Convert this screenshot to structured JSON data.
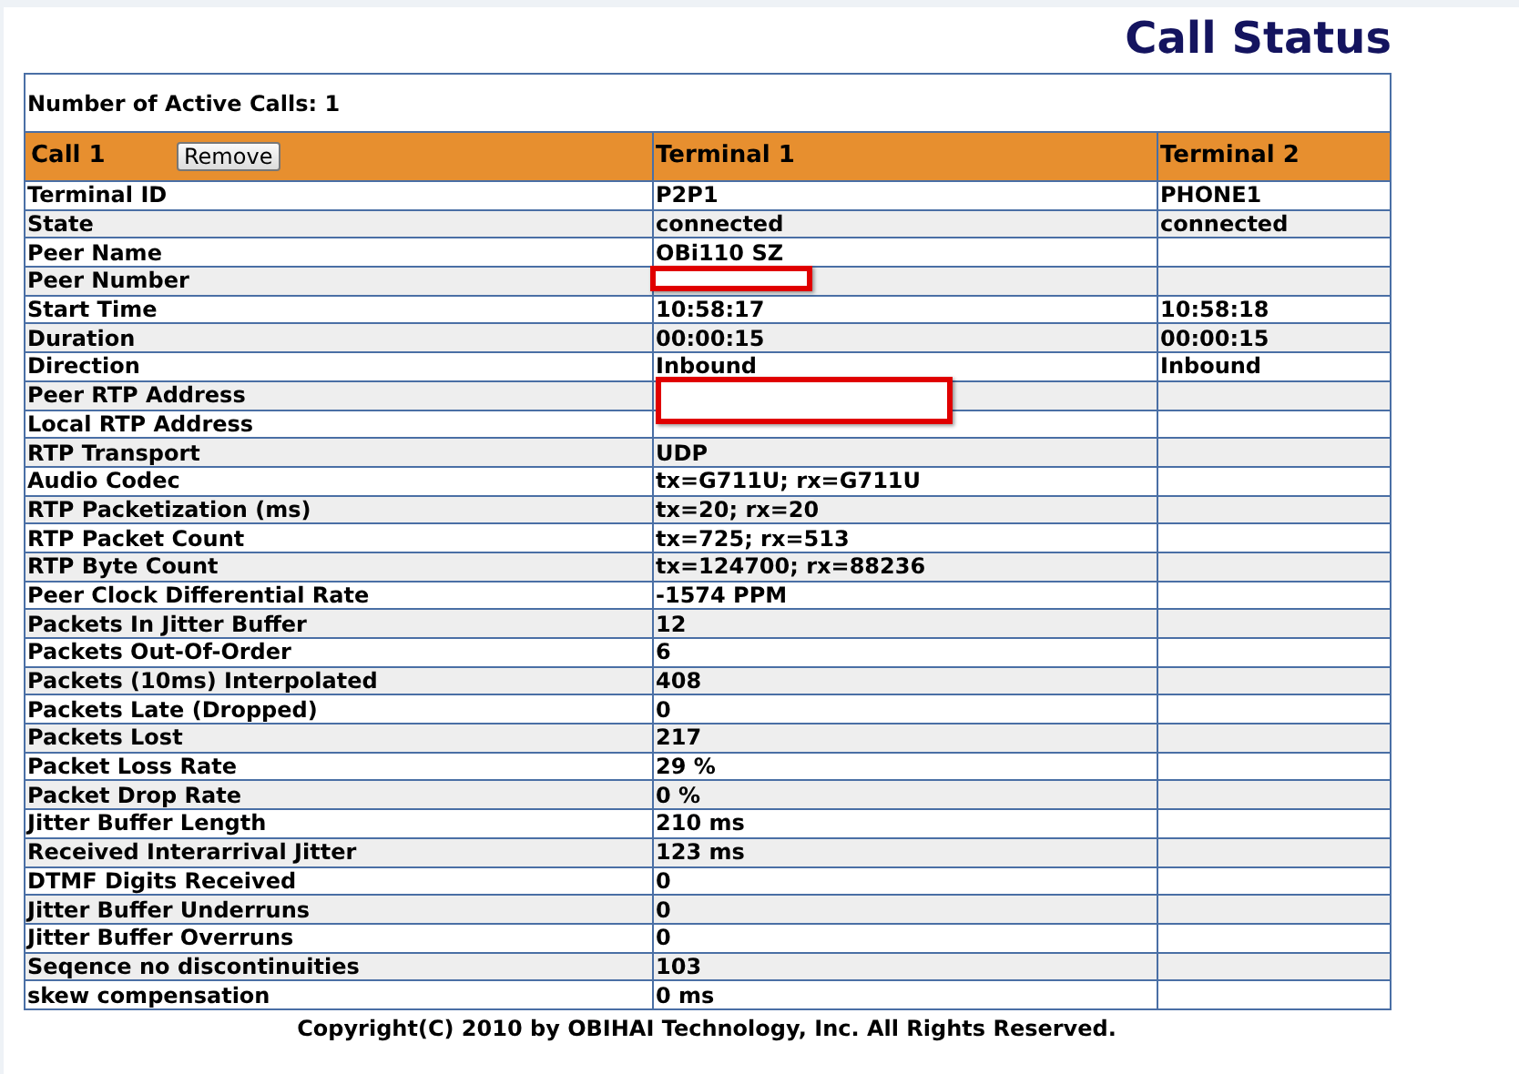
{
  "title": "Call Status",
  "active_calls": "Number of Active Calls: 1",
  "header": {
    "call": "Call 1",
    "button": "Remove",
    "columns": [
      "Terminal 1",
      "Terminal 2"
    ]
  },
  "rows": [
    {
      "label": "Terminal ID",
      "values": [
        "P2P1",
        "PHONE1"
      ]
    },
    {
      "label": "State",
      "values": [
        "connected",
        "connected"
      ]
    },
    {
      "label": "Peer Name",
      "values": [
        "OBi110 SZ"
      ]
    },
    {
      "label": "Peer Number",
      "values": [],
      "redacted": true,
      "redaction_wide": false
    },
    {
      "label": "Start Time",
      "values": [
        "10:58:17",
        "10:58:18"
      ]
    },
    {
      "label": "Duration",
      "values": [
        "00:00:15",
        "00:00:15"
      ]
    },
    {
      "label": "Direction",
      "values": [
        "Inbound",
        "Inbound"
      ]
    },
    {
      "label": "Peer RTP Address",
      "values": [],
      "redacted": true,
      "redaction_wide": true
    },
    {
      "label": "Local RTP Address",
      "values": []
    },
    {
      "label": "RTP Transport",
      "values": [
        "UDP"
      ]
    },
    {
      "label": "Audio Codec",
      "values": [
        "tx=G711U; rx=G711U"
      ]
    },
    {
      "label": "RTP Packetization (ms)",
      "values": [
        "tx=20; rx=20"
      ]
    },
    {
      "label": "RTP Packet Count",
      "values": [
        "tx=725; rx=513"
      ]
    },
    {
      "label": "RTP Byte Count",
      "values": [
        "tx=124700; rx=88236"
      ]
    },
    {
      "label": "Peer Clock Differential Rate",
      "values": [
        "-1574 PPM"
      ]
    },
    {
      "label": "Packets In Jitter Buffer",
      "values": [
        "12"
      ]
    },
    {
      "label": "Packets Out-Of-Order",
      "values": [
        "6"
      ]
    },
    {
      "label": "Packets (10ms) Interpolated",
      "values": [
        "408"
      ]
    },
    {
      "label": "Packets Late (Dropped)",
      "values": [
        "0"
      ]
    },
    {
      "label": "Packets Lost",
      "values": [
        "217"
      ]
    },
    {
      "label": "Packet Loss Rate",
      "values": [
        "29 %"
      ]
    },
    {
      "label": "Packet Drop Rate",
      "values": [
        "0 %"
      ]
    },
    {
      "label": "Jitter Buffer Length",
      "values": [
        "210 ms"
      ]
    },
    {
      "label": "Received Interarrival Jitter",
      "values": [
        "123 ms"
      ]
    },
    {
      "label": "DTMF Digits Received",
      "values": [
        "0"
      ]
    },
    {
      "label": "Jitter Buffer Underruns",
      "values": [
        "0"
      ]
    },
    {
      "label": "Jitter Buffer Overruns",
      "values": [
        "0"
      ]
    },
    {
      "label": "Seqence no discontinuities",
      "values": [
        "103"
      ]
    },
    {
      "label": "skew compensation",
      "values": [
        "0 ms"
      ]
    }
  ],
  "footer": "Copyright(C) 2010 by OBIHAI Technology, Inc. All Rights Reserved."
}
